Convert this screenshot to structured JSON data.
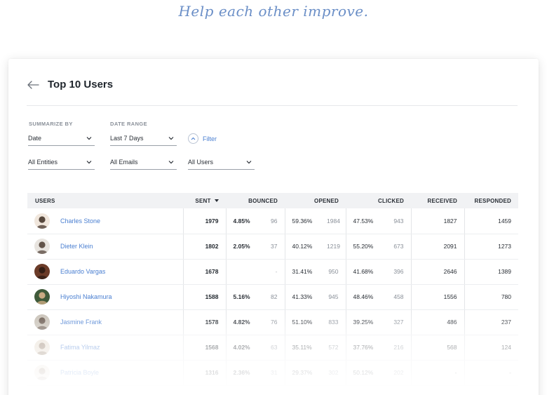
{
  "tagline": "Help each other improve.",
  "page": {
    "title": "Top 10 Users"
  },
  "filters": {
    "summarize_label": "SUMMARIZE BY",
    "summarize_value": "Date",
    "date_range_label": "DATE RANGE",
    "date_range_value": "Last 7 Days",
    "filter_label": "Filter",
    "entities_value": "All Entities",
    "emails_value": "All Emails",
    "users_value": "All Users"
  },
  "table": {
    "headers": {
      "users": "USERS",
      "sent": "SENT",
      "bounced": "BOUNCED",
      "opened": "OPENED",
      "clicked": "CLICKED",
      "received": "RECEIVED",
      "responded": "RESPONDED"
    },
    "rows": [
      {
        "name": "Charles Stone",
        "sent": "1979",
        "bounced_pct": "4.85%",
        "bounced_count": "96",
        "opened_pct": "59.36%",
        "opened_count": "1984",
        "clicked_pct": "47.53%",
        "clicked_count": "943",
        "received": "1827",
        "responded": "1459"
      },
      {
        "name": "Dieter Klein",
        "sent": "1802",
        "bounced_pct": "2.05%",
        "bounced_count": "37",
        "opened_pct": "40.12%",
        "opened_count": "1219",
        "clicked_pct": "55.20%",
        "clicked_count": "673",
        "received": "2091",
        "responded": "1273"
      },
      {
        "name": "Eduardo Vargas",
        "sent": "1678",
        "bounced_pct": "",
        "bounced_count": "-",
        "opened_pct": "31.41%",
        "opened_count": "950",
        "clicked_pct": "41.68%",
        "clicked_count": "396",
        "received": "2646",
        "responded": "1389"
      },
      {
        "name": "Hiyoshi Nakamura",
        "sent": "1588",
        "bounced_pct": "5.16%",
        "bounced_count": "82",
        "opened_pct": "41.33%",
        "opened_count": "945",
        "clicked_pct": "48.46%",
        "clicked_count": "458",
        "received": "1556",
        "responded": "780"
      },
      {
        "name": "Jasmine Frank",
        "sent": "1578",
        "bounced_pct": "4.82%",
        "bounced_count": "76",
        "opened_pct": "51.10%",
        "opened_count": "833",
        "clicked_pct": "39.25%",
        "clicked_count": "327",
        "received": "486",
        "responded": "237"
      },
      {
        "name": "Fatima Yilmaz",
        "sent": "1568",
        "bounced_pct": "4.02%",
        "bounced_count": "63",
        "opened_pct": "35.11%",
        "opened_count": "572",
        "clicked_pct": "37.76%",
        "clicked_count": "216",
        "received": "568",
        "responded": "124"
      },
      {
        "name": "Patricia Boyle",
        "sent": "1316",
        "bounced_pct": "2.36%",
        "bounced_count": "31",
        "opened_pct": "29.37%",
        "opened_count": "302",
        "clicked_pct": "50.12%",
        "clicked_count": "202",
        "received": "-",
        "responded": "-"
      }
    ]
  },
  "colors": {
    "link": "#4a7fd1",
    "tagline": "#6b8fc7",
    "header_bg": "#f1f2f4"
  }
}
